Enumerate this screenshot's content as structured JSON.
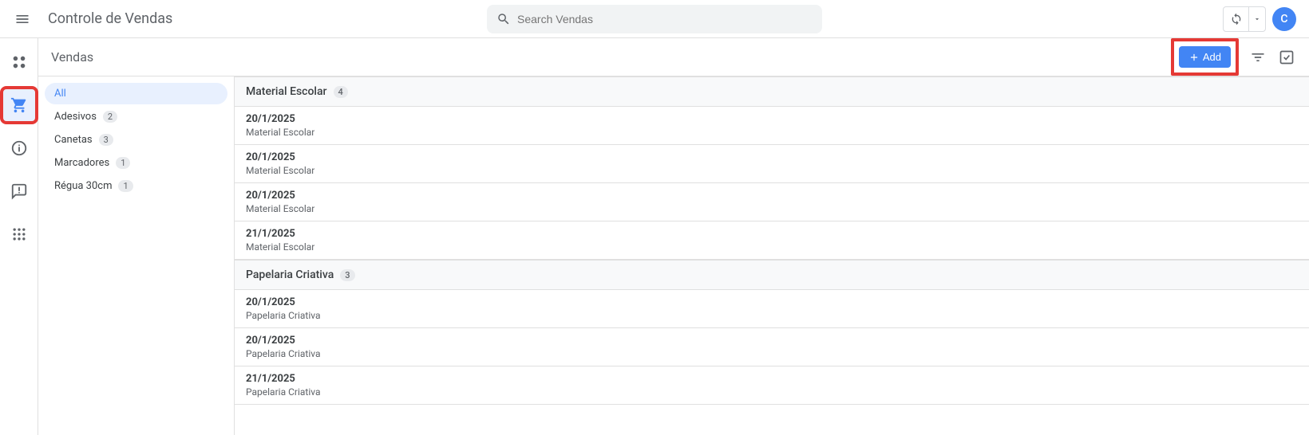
{
  "header": {
    "app_title": "Controle de Vendas",
    "search_placeholder": "Search Vendas",
    "avatar_initial": "C"
  },
  "toolbar": {
    "title": "Vendas",
    "add_label": "Add"
  },
  "sidebar": {
    "items": [
      {
        "label": "All",
        "count": null,
        "active": true
      },
      {
        "label": "Adesivos",
        "count": "2",
        "active": false
      },
      {
        "label": "Canetas",
        "count": "3",
        "active": false
      },
      {
        "label": "Marcadores",
        "count": "1",
        "active": false
      },
      {
        "label": "Régua 30cm",
        "count": "1",
        "active": false
      }
    ]
  },
  "groups": [
    {
      "label": "Material Escolar",
      "count": "4",
      "rows": [
        {
          "date": "20/1/2025",
          "cat": "Material Escolar"
        },
        {
          "date": "20/1/2025",
          "cat": "Material Escolar"
        },
        {
          "date": "20/1/2025",
          "cat": "Material Escolar"
        },
        {
          "date": "21/1/2025",
          "cat": "Material Escolar"
        }
      ]
    },
    {
      "label": "Papelaria Criativa",
      "count": "3",
      "rows": [
        {
          "date": "20/1/2025",
          "cat": "Papelaria Criativa"
        },
        {
          "date": "20/1/2025",
          "cat": "Papelaria Criativa"
        },
        {
          "date": "21/1/2025",
          "cat": "Papelaria Criativa"
        }
      ]
    }
  ]
}
